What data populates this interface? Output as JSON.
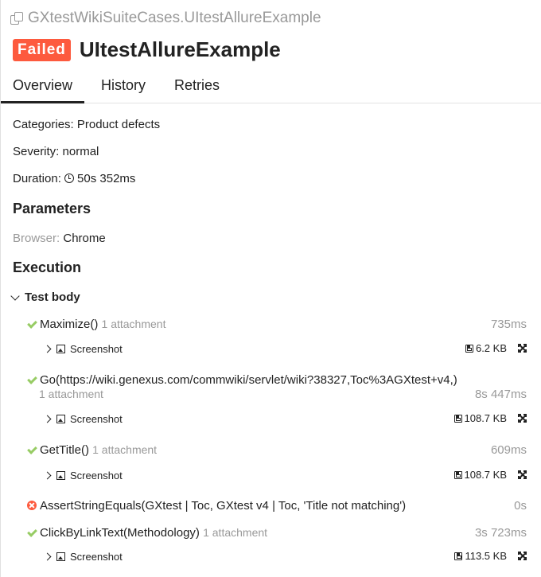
{
  "breadcrumb": "GXtestWikiSuiteCases.UItestAllureExample",
  "status_badge": "Failed",
  "title": "UItestAllureExample",
  "tabs": [
    "Overview",
    "History",
    "Retries"
  ],
  "overview": {
    "categories_label": "Categories:",
    "categories_value": "Product defects",
    "severity_label": "Severity:",
    "severity_value": "normal",
    "duration_label": "Duration:",
    "duration_value": "50s 352ms"
  },
  "parameters": {
    "heading": "Parameters",
    "key": "Browser:",
    "value": "Chrome"
  },
  "execution": {
    "heading": "Execution",
    "test_body": "Test body",
    "steps": [
      {
        "name": "Maximize()",
        "meta": "1 attachment",
        "time": "735ms",
        "status": "passed",
        "attachment": {
          "label": "Screenshot",
          "size": "6.2 KB"
        }
      },
      {
        "name": "Go(https://wiki.genexus.com/commwiki/servlet/wiki?38327,Toc%3AGXtest+v4,)",
        "meta": "1 attachment",
        "time": "8s 447ms",
        "status": "passed",
        "attachment": {
          "label": "Screenshot",
          "size": "108.7 KB"
        }
      },
      {
        "name": "GetTitle()",
        "meta": "1 attachment",
        "time": "609ms",
        "status": "passed",
        "attachment": {
          "label": "Screenshot",
          "size": "108.7 KB"
        }
      },
      {
        "name": "AssertStringEquals(GXtest | Toc, GXtest v4 | Toc, 'Title not matching')",
        "meta": "",
        "time": "0s",
        "status": "failed"
      },
      {
        "name": "ClickByLinkText(Methodology)",
        "meta": "1 attachment",
        "time": "3s 723ms",
        "status": "passed",
        "attachment": {
          "label": "Screenshot",
          "size": "113.5 KB"
        }
      }
    ]
  },
  "colors": {
    "failed": "#fd5a3e",
    "passed": "#97cc64",
    "muted": "#999999"
  }
}
